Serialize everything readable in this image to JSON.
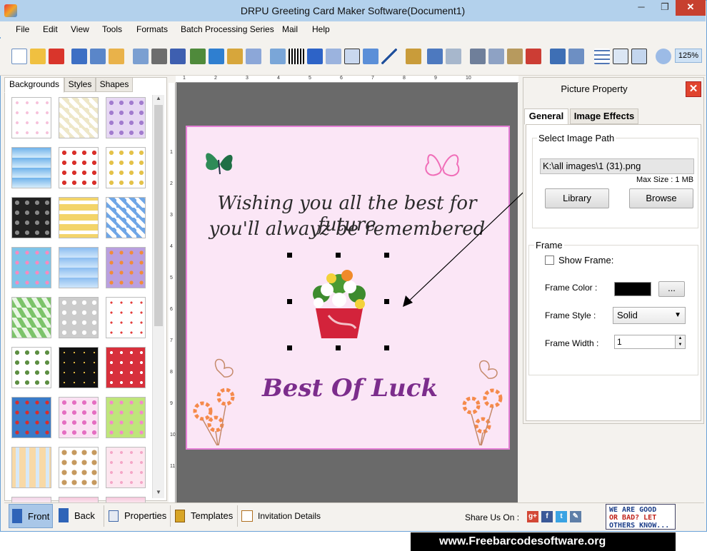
{
  "window": {
    "title": "DRPU Greeting Card Maker Software(Document1)",
    "min_glyph": "─",
    "max_glyph": "❐",
    "close_glyph": "✕"
  },
  "menu": [
    "File",
    "Edit",
    "View",
    "Tools",
    "Formats",
    "Batch Processing Series",
    "Mail",
    "Help"
  ],
  "toolbar": {
    "zoom": "125%"
  },
  "left_panel": {
    "tabs": [
      "Backgrounds",
      "Styles",
      "Shapes"
    ],
    "active_tab": "Backgrounds"
  },
  "ruler": {
    "top_ticks": [
      "1",
      "2",
      "3",
      "4",
      "5",
      "6",
      "7",
      "8",
      "9",
      "10"
    ],
    "left_ticks": [
      "1",
      "2",
      "3",
      "4",
      "5",
      "6",
      "7",
      "8",
      "9",
      "10",
      "11"
    ]
  },
  "card": {
    "line1": "Wishing you all the best for future",
    "line2": "you'll alwayz be remembered",
    "headline": "Best Of Luck"
  },
  "picture_property": {
    "title": "Picture Property",
    "close_glyph": "✕",
    "tabs": [
      "General",
      "Image Effects"
    ],
    "active_tab": "General",
    "select_image_path_label": "Select Image Path",
    "image_path": "K:\\all images\\1 (31).png",
    "max_size": "Max Size : 1 MB",
    "library_button": "Library",
    "browse_button": "Browse",
    "frame_group": "Frame",
    "show_frame_label": "Show Frame:",
    "show_frame_checked": false,
    "frame_color_label": "Frame Color :",
    "frame_color": "#000000",
    "frame_color_button": "...",
    "frame_style_label": "Frame Style :",
    "frame_style": "Solid",
    "frame_width_label": "Frame Width :",
    "frame_width": "1"
  },
  "bottom": {
    "front": "Front",
    "back": "Back",
    "properties": "Properties",
    "templates": "Templates",
    "invitation": "Invitation Details",
    "share_label": "Share Us On :",
    "social": [
      "g+",
      "f",
      "t",
      "✎"
    ],
    "feedback_lines": [
      "WE ARE GOOD",
      "OR BAD? LET",
      "OTHERS KNOW..."
    ]
  },
  "footer": {
    "url": "www.Freebarcodesoftware.org"
  },
  "colors": {
    "accent": "#7c2d8c",
    "card_bg": "#fbe6f6",
    "card_border": "#e57fd7",
    "canvas": "#6a6a6a"
  }
}
